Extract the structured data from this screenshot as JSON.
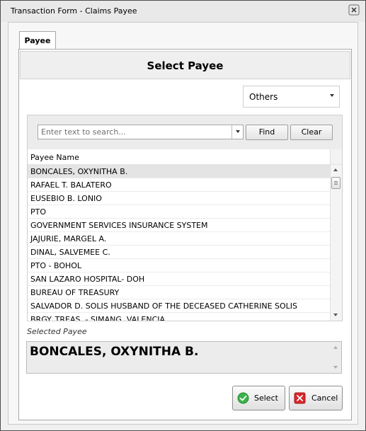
{
  "window": {
    "title": "Transaction Form - Claims Payee"
  },
  "tabs": [
    {
      "label": "Payee"
    }
  ],
  "header": {
    "title": "Select Payee"
  },
  "payee_type": {
    "value": "Others"
  },
  "search": {
    "placeholder": "Enter text to search...",
    "value": "",
    "find_label": "Find",
    "clear_label": "Clear"
  },
  "grid": {
    "column_header": "Payee Name",
    "rows": [
      "BONCALES, OXYNITHA B.",
      "RAFAEL T. BALATERO",
      "EUSEBIO B. LONIO",
      "PTO",
      "GOVERNMENT SERVICES INSURANCE SYSTEM",
      "JAJURIE, MARGEL A.",
      "DINAL, SALVEMEE C.",
      "PTO - BOHOL",
      "SAN LAZARO HOSPITAL- DOH",
      "BUREAU OF TREASURY",
      "SALVADOR D. SOLIS HUSBAND OF THE DECEASED CATHERINE SOLIS",
      "BRGY. TREAS. - SIMANG, VALENCIA"
    ],
    "selected_index": 0
  },
  "selected_payee": {
    "label": "Selected Payee",
    "value": "BONCALES, OXYNITHA B."
  },
  "buttons": {
    "select_label": "Select",
    "cancel_label": "Cancel"
  },
  "colors": {
    "selected_row": "#e4e4e4",
    "select_icon": "#3bb24a",
    "cancel_icon": "#d8262c"
  }
}
